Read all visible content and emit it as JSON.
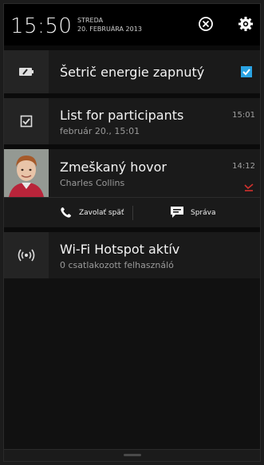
{
  "status": {
    "time": "15:50",
    "day": "STREDA",
    "date": "20. FEBRUÁRA 2013"
  },
  "header_icons": {
    "dismiss": "close-circle-icon",
    "settings": "gear-icon"
  },
  "notifications": [
    {
      "title": "Šetrič energie zapnutý",
      "icon": "battery-saver-icon",
      "checked": true
    },
    {
      "title": "List for participants",
      "subtitle": "február 20., 15:01",
      "time": "15:01",
      "icon": "checkbox-task-icon"
    },
    {
      "title": "Zmeškaný hovor",
      "subtitle": "Charles Collins",
      "time": "14:12",
      "icon": "missed-call-icon",
      "actions": [
        {
          "label": "Zavolať späť",
          "icon": "phone-icon"
        },
        {
          "label": "Správa",
          "icon": "message-icon"
        }
      ]
    },
    {
      "title": "Wi-Fi Hotspot aktív",
      "subtitle": "0 csatlakozott felhasználó",
      "icon": "wifi-hotspot-icon"
    }
  ],
  "colors": {
    "accent": "#2aa3e3",
    "missed": "#d0312d"
  }
}
